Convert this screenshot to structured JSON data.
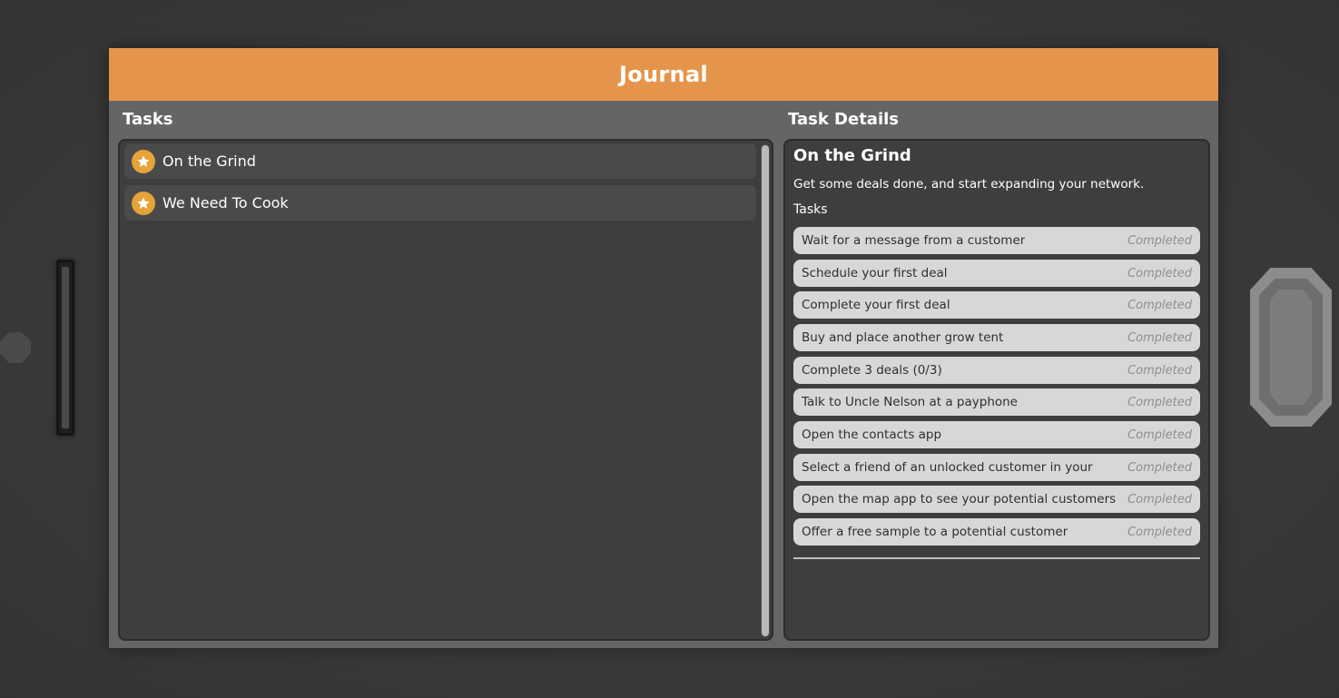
{
  "journal": {
    "title": "Journal",
    "tasks_heading": "Tasks",
    "details_heading": "Task Details",
    "accent_color": "#e5954b",
    "star_color": "#e5a33a"
  },
  "task_list": [
    {
      "label": "On the Grind",
      "icon": "star-icon"
    },
    {
      "label": "We Need To Cook",
      "icon": "star-icon"
    }
  ],
  "task_details": {
    "title": "On the Grind",
    "description": "Get some deals done, and start expanding your network.",
    "subtasks_heading": "Tasks",
    "subtasks": [
      {
        "label": "Wait for a message from a customer",
        "status": "Completed"
      },
      {
        "label": "Schedule your first deal",
        "status": "Completed"
      },
      {
        "label": "Complete your first deal",
        "status": "Completed"
      },
      {
        "label": "Buy and place another grow tent",
        "status": "Completed"
      },
      {
        "label": "Complete 3 deals (0/3)",
        "status": "Completed"
      },
      {
        "label": "Talk to Uncle Nelson at a payphone",
        "status": "Completed"
      },
      {
        "label": "Open the contacts app",
        "status": "Completed"
      },
      {
        "label": "Select a friend of an unlocked customer in your",
        "status": "Completed"
      },
      {
        "label": "Open the map app to see your potential customers",
        "status": "Completed"
      },
      {
        "label": "Offer a free sample to a potential customer",
        "status": "Completed"
      }
    ]
  }
}
